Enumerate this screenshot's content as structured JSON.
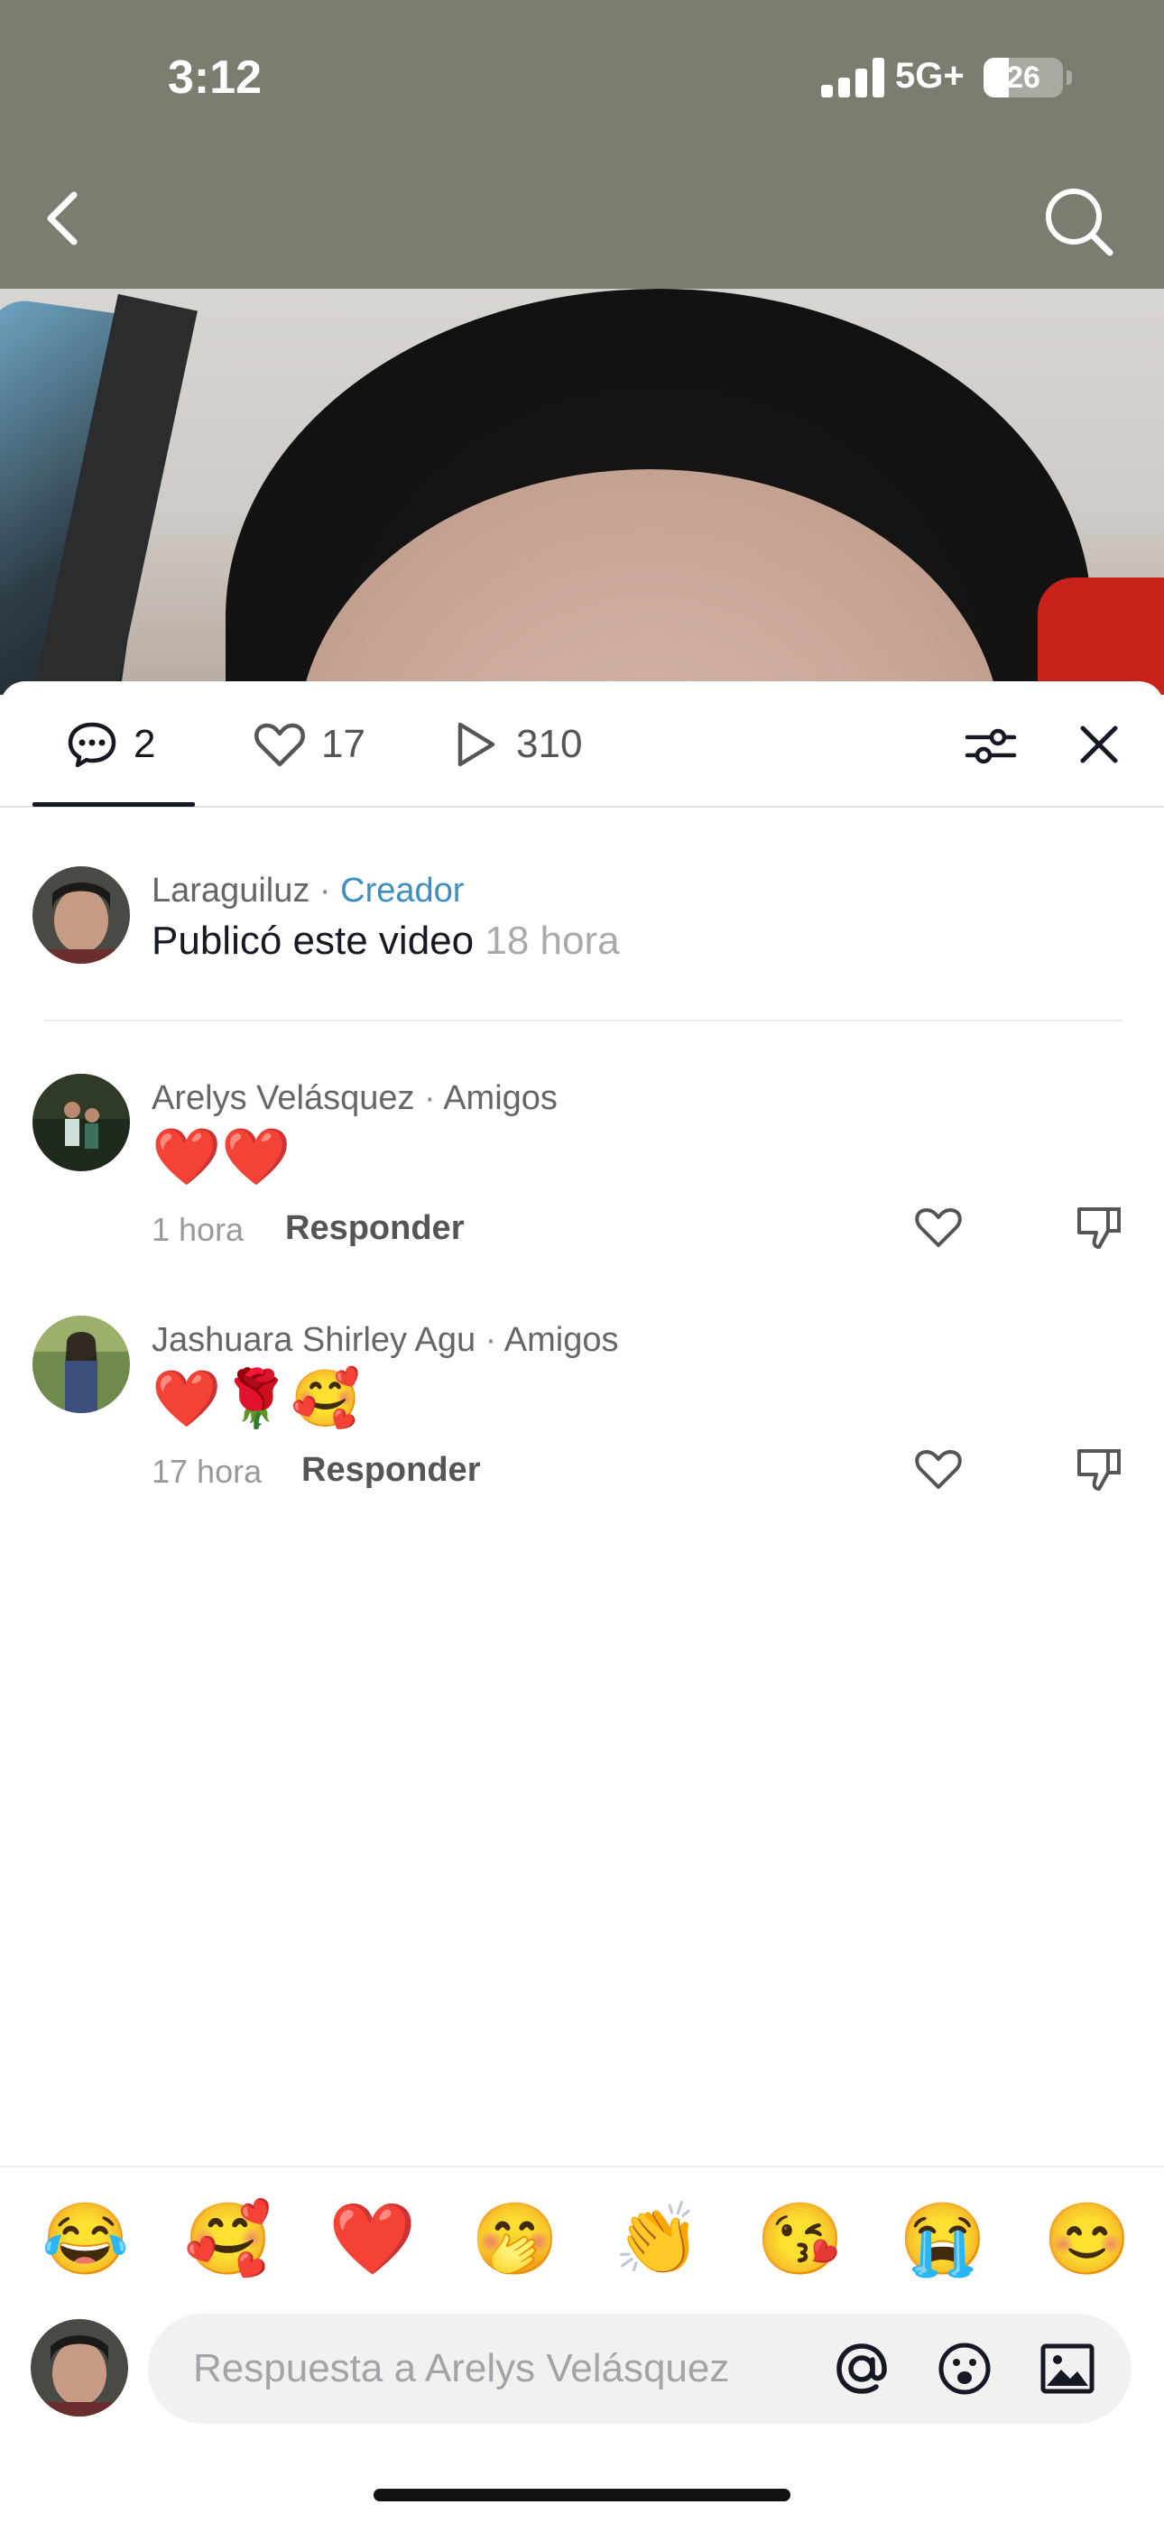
{
  "status_bar": {
    "time": "3:12",
    "network": "5G+",
    "battery": "26"
  },
  "tabs": {
    "comments_count": "2",
    "likes_count": "17",
    "views_count": "310"
  },
  "creator_post": {
    "name": "Laraguiluz",
    "separator": " · ",
    "tag": "Creador",
    "text": "Publicó este video",
    "time": "18 hora"
  },
  "comments": [
    {
      "name": "Arelys Velásquez",
      "separator": " · ",
      "relation": "Amigos",
      "text": "❤️❤️",
      "time": "1 hora",
      "reply_label": "Responder"
    },
    {
      "name": "Jashuara Shirley Agu",
      "separator": " · ",
      "relation": "Amigos",
      "text": "❤️🌹🥰",
      "time": "17 hora",
      "reply_label": "Responder"
    }
  ],
  "quick_emojis": [
    "😂",
    "🥰",
    "❤️",
    "🤭",
    "👏",
    "😘",
    "😭",
    "😊"
  ],
  "input": {
    "placeholder": "Respuesta a Arelys Velásquez",
    "value": ""
  },
  "colors": {
    "creator_tag": "#3d8fbf",
    "text": "#161823",
    "muted": "#999999"
  },
  "icons": [
    "back-icon",
    "search-icon",
    "comment-icon",
    "heart-icon",
    "play-icon",
    "filter-icon",
    "close-icon",
    "dislike-icon",
    "at-icon",
    "emoji-icon",
    "image-icon"
  ]
}
